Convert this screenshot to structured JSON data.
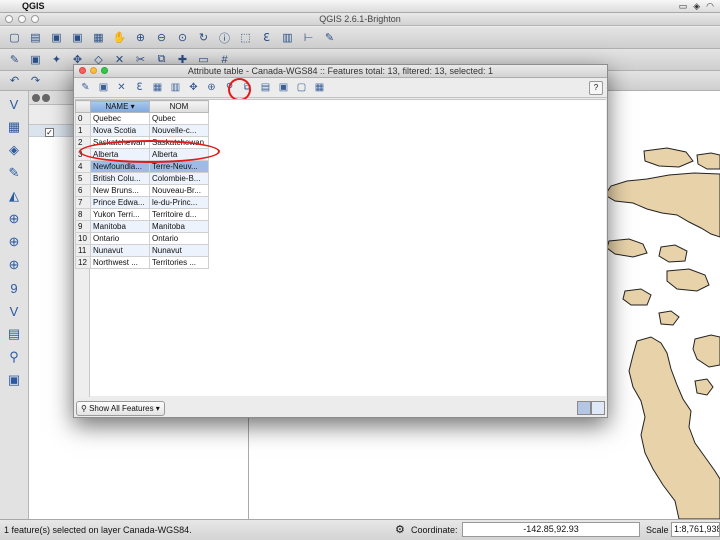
{
  "menubar": {
    "app_name": "QGIS"
  },
  "window": {
    "title": "QGIS 2.6.1-Brighton"
  },
  "attribute_table": {
    "title": "Attribute table - Canada-WGS84 :: Features total: 13, filtered: 13, selected: 1",
    "help_label": "?",
    "columns": [
      "NAME",
      "NOM"
    ],
    "rows": [
      {
        "index": "0",
        "name": "Quebec",
        "nom": "Qubec"
      },
      {
        "index": "1",
        "name": "Nova Scotia",
        "nom": "Nouvelle-c..."
      },
      {
        "index": "2",
        "name": "Saskatchewan",
        "nom": "Saskatchewan"
      },
      {
        "index": "3",
        "name": "Alberta",
        "nom": "Alberta"
      },
      {
        "index": "4",
        "name": "Newfoundla...",
        "nom": "Terre-Neuv..."
      },
      {
        "index": "5",
        "name": "British Colu...",
        "nom": "Colombie-B..."
      },
      {
        "index": "6",
        "name": "New Bruns...",
        "nom": "Nouveau-Br..."
      },
      {
        "index": "7",
        "name": "Prince Edwa...",
        "nom": "le-du-Princ..."
      },
      {
        "index": "8",
        "name": "Yukon Terri...",
        "nom": "Territoire d..."
      },
      {
        "index": "9",
        "name": "Manitoba",
        "nom": "Manitoba"
      },
      {
        "index": "10",
        "name": "Ontario",
        "nom": "Ontario"
      },
      {
        "index": "11",
        "name": "Nunavut",
        "nom": "Nunavut"
      },
      {
        "index": "12",
        "name": "Northwest ...",
        "nom": "Territories ..."
      }
    ],
    "selected_row": 4,
    "filter_button_label": "Show All Features"
  },
  "statusbar": {
    "message": "1 feature(s) selected on layer Canada-WGS84.",
    "coordinate_label": "Coordinate:",
    "coordinate_value": "-142.85,92.93",
    "scale_label": "Scale",
    "scale_value": "1:8,761,938"
  },
  "colors": {
    "map_fill": "#e8d2a9",
    "map_stroke": "#222222",
    "selection": "#9dbbe5",
    "annotation_red": "#e01b1b"
  },
  "icons": {
    "toolbar": [
      "new-project-icon",
      "open-icon",
      "save-icon",
      "save-as-icon",
      "print-composer-icon",
      "pan-icon",
      "zoom-in-icon",
      "zoom-out-icon",
      "zoom-full-icon",
      "refresh-icon",
      "identify-icon",
      "select-icon",
      "field-calculator-icon",
      "attribute-table-icon",
      "measure-icon",
      "annotation-icon"
    ],
    "dialog_toolbar": [
      "toggle-editing-icon",
      "save-edits-icon",
      "delete-selected-icon",
      "expression-select-icon",
      "select-all-icon",
      "invert-selection-icon",
      "move-selection-top-icon",
      "pan-to-selected-icon",
      "zoom-to-selected-icon",
      "copy-selected-icon",
      "paste-icon",
      "new-column-icon",
      "delete-column-icon",
      "field-calculator-icon"
    ]
  }
}
